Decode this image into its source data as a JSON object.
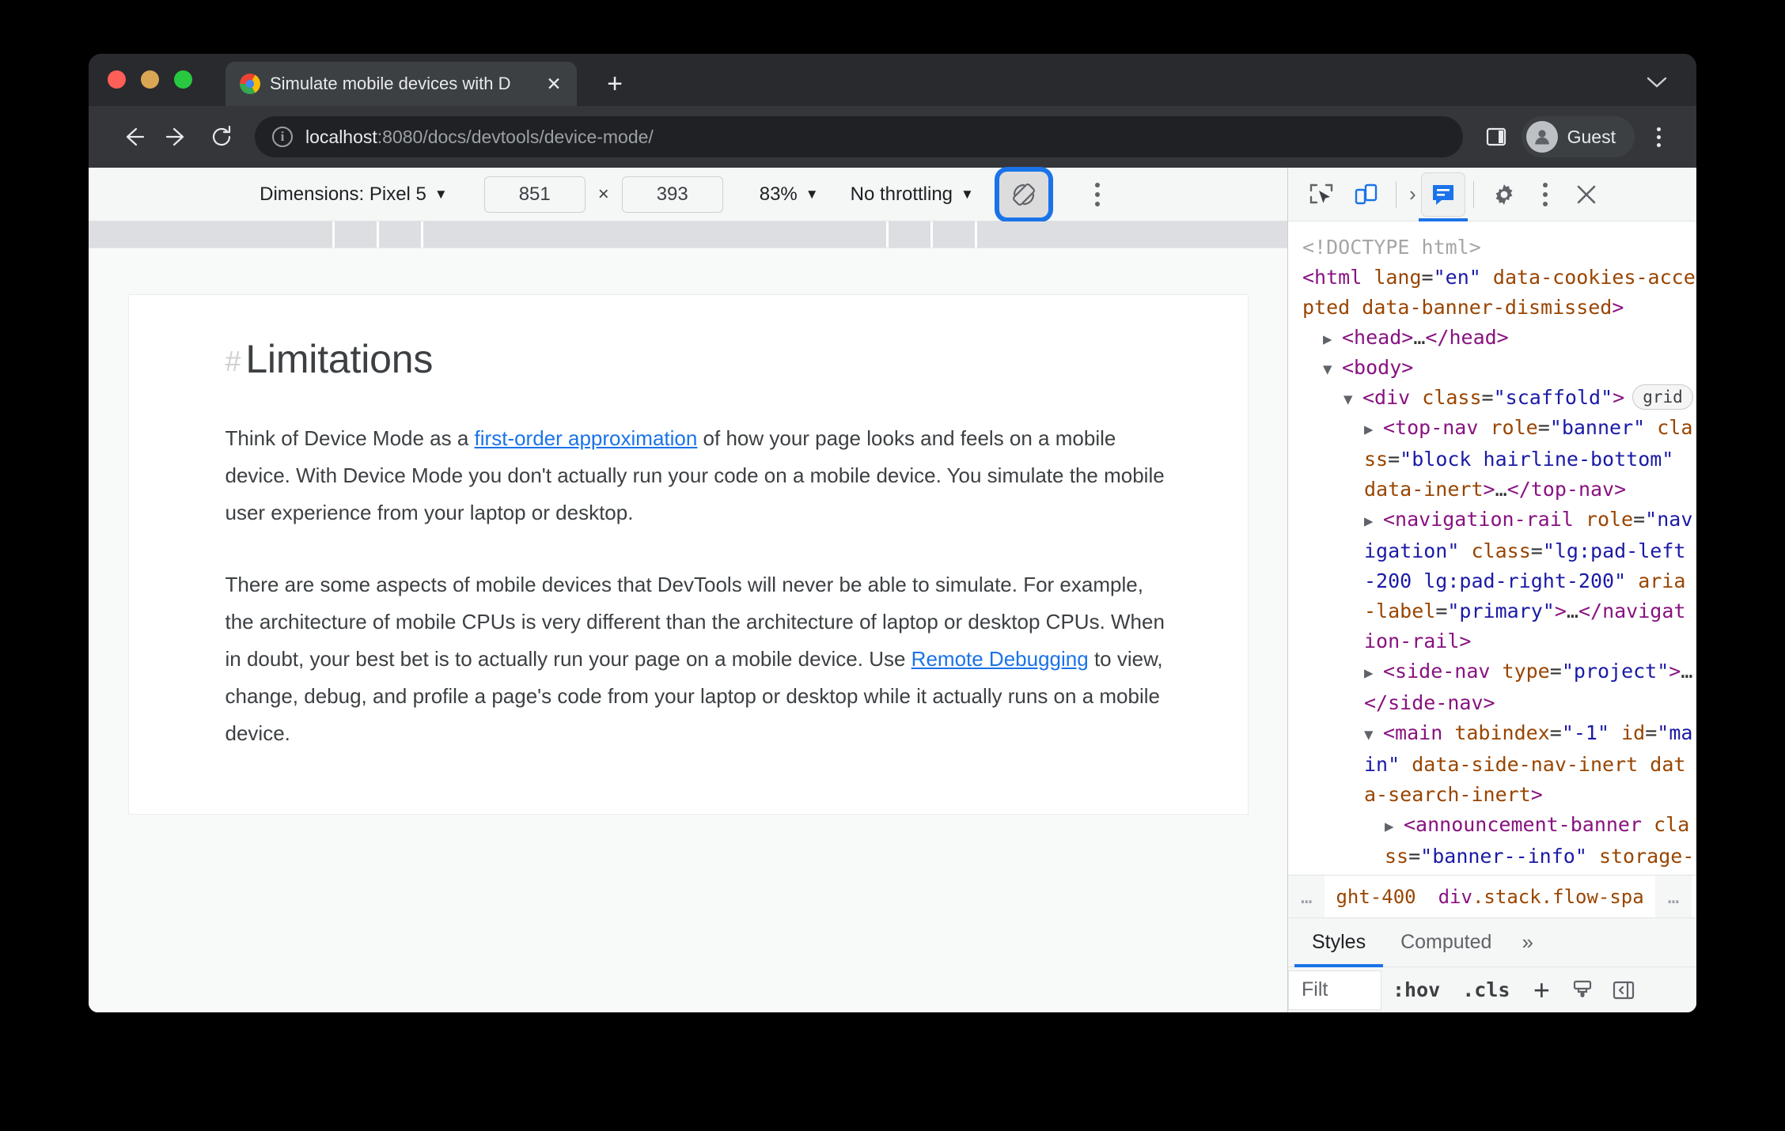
{
  "browser": {
    "tab": {
      "title": "Simulate mobile devices with D",
      "close_label": "✕",
      "favicon": "chrome-icon"
    },
    "new_tab_label": "+",
    "window_caret": "⌄",
    "omnibox": {
      "host": "localhost",
      "path": ":8080/docs/devtools/device-mode/",
      "security_icon": "info-icon"
    },
    "profile": {
      "name": "Guest",
      "avatar_icon": "person-icon"
    },
    "menu_icon": "kebab-menu-icon",
    "side_panel_icon": "side-panel-icon",
    "back_icon": "arrow-left-icon",
    "forward_icon": "arrow-right-icon",
    "reload_icon": "reload-icon"
  },
  "device_toolbar": {
    "dimensions_label": "Dimensions: Pixel 5",
    "dimensions_caret": "▼",
    "width": "851",
    "multiply": "×",
    "height": "393",
    "zoom": "83%",
    "zoom_caret": "▼",
    "throttling": "No throttling",
    "throttling_caret": "▼",
    "rotate_icon": "rotate-device-icon",
    "more_icon": "kebab-menu-icon",
    "focus_ring_color": "#1a73e8"
  },
  "page": {
    "heading_hash": "#",
    "heading": "Limitations",
    "paragraph1_a": "Think of Device Mode as a ",
    "paragraph1_link": "first-order approximation",
    "paragraph1_b": " of how your page looks and feels on a mobile device. With Device Mode you don't actually run your code on a mobile device. You simulate the mobile user experience from your laptop or desktop.",
    "paragraph2_a": "There are some aspects of mobile devices that DevTools will never be able to simulate. For example, the architecture of mobile CPUs is very different than the architecture of laptop or desktop CPUs. When in doubt, your best bet is to actually run your page on a mobile device. Use ",
    "paragraph2_link": "Remote Debugging",
    "paragraph2_b": " to view, change, debug, and profile a page's code from your laptop or desktop while it actually runs on a mobile device.",
    "link_color": "#1a73e8"
  },
  "devtools": {
    "toolbar": {
      "inspect_icon": "inspect-element-icon",
      "device_toggle_icon": "toggle-device-toolbar-icon",
      "more_tabs_chevron": "›",
      "console_icon": "console-panel-icon",
      "settings_icon": "gear-icon",
      "more_icon": "kebab-menu-icon",
      "close_icon": "close-icon",
      "active_accent": "#1a73e8"
    },
    "dom": {
      "doctype": "<!DOCTYPE html>",
      "lines": [
        {
          "id": "html-open",
          "text": "<html lang=\"en\" data-cookies-accepted data-banner-dismissed>"
        },
        {
          "id": "head",
          "text": "<head>…</head>"
        },
        {
          "id": "body",
          "text": "<body>"
        },
        {
          "id": "div-scaffold",
          "text": "<div class=\"scaffold\">",
          "badge": "grid"
        },
        {
          "id": "top-nav",
          "text": "<top-nav role=\"banner\" class=\"block hairline-bottom\" data-inert>…</top-nav>"
        },
        {
          "id": "navigation-rail",
          "text": "<navigation-rail role=\"navigation\" class=\"lg:pad-left-200 lg:pad-right-200\" aria-label=\"primary\">…</navigation-rail>"
        },
        {
          "id": "side-nav",
          "text": "<side-nav type=\"project\">…</side-nav>"
        },
        {
          "id": "main",
          "text": "<main tabindex=\"-1\" id=\"main\" data-side-nav-inert data-search-inert>"
        },
        {
          "id": "announcement-banner",
          "text": "<announcement-banner class=\"banner--info\" storage-key=\"banner\">"
        }
      ]
    },
    "breadcrumb": {
      "left_ellipsis": "…",
      "items": [
        "ght-400",
        "div.stack.flow-spa"
      ],
      "right_ellipsis": "…"
    },
    "sidebar": {
      "tabs": [
        {
          "label": "Styles",
          "active": true
        },
        {
          "label": "Computed",
          "active": false
        }
      ],
      "more_tabs": "»",
      "filter_placeholder": "Filt",
      "hov_label": ":hov",
      "cls_label": ".cls",
      "add_rule_label": "+",
      "paintbrush_icon": "paintbrush-icon",
      "computed_sidebar_icon": "toggle-sidebar-icon"
    }
  }
}
